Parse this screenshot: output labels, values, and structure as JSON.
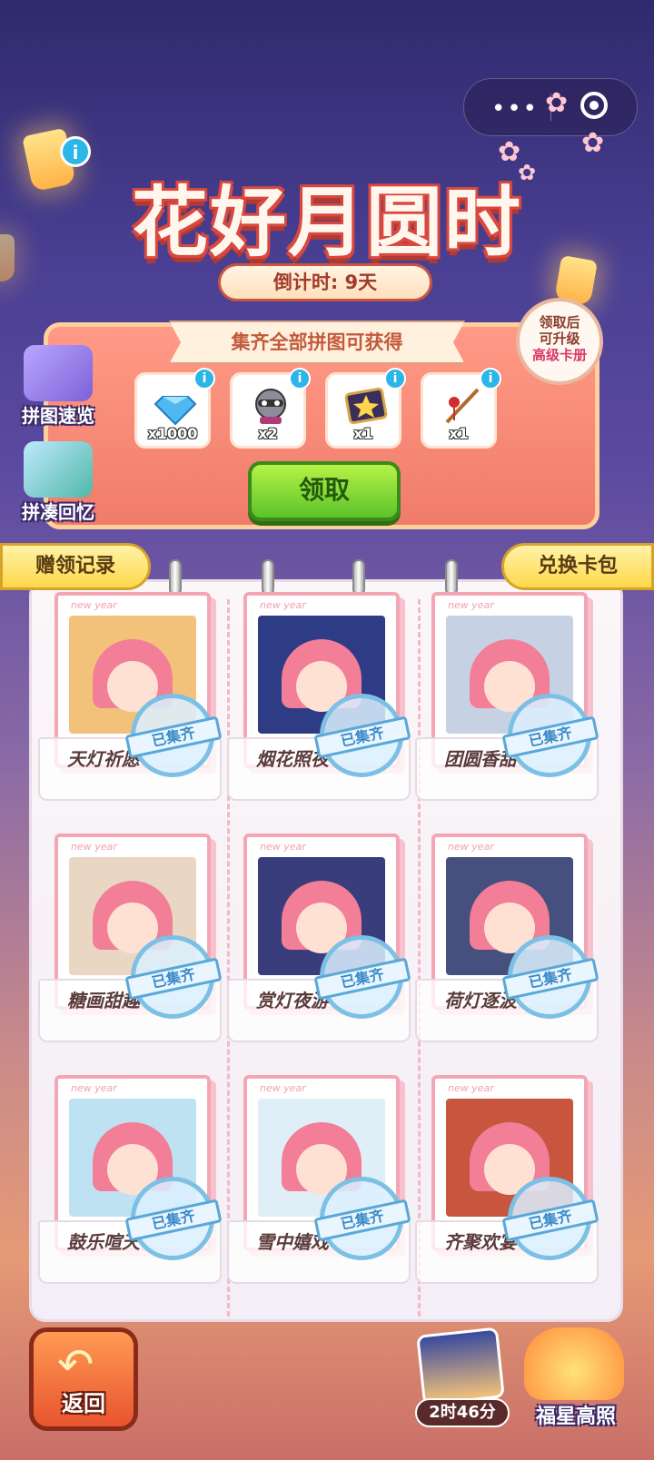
{
  "header": {
    "title": "花好月圆时",
    "countdown": "倒计时: 9天"
  },
  "reward_panel": {
    "banner": "集齐全部拼图可获得",
    "upgrade_badge": [
      "领取后",
      "可升级",
      "高级卡册"
    ],
    "rewards": [
      {
        "icon": "diamond-icon",
        "qty": "x1000"
      },
      {
        "icon": "raccoon-icon",
        "qty": "x2"
      },
      {
        "icon": "star-card-icon",
        "qty": "x1"
      },
      {
        "icon": "fishing-rod-icon",
        "qty": "x1"
      }
    ],
    "claim_label": "领取"
  },
  "side": {
    "preview_label": "拼图速览",
    "memory_label": "拼凑回忆"
  },
  "tabs": {
    "gift_record": "赠领记录",
    "exchange_pack": "兑换卡包"
  },
  "cards": [
    {
      "name": "天灯祈愿",
      "tag": "new year",
      "stamp": "已集齐",
      "art_color": "#f3c27a"
    },
    {
      "name": "烟花照夜",
      "tag": "new year",
      "stamp": "已集齐",
      "art_color": "#2d3c84"
    },
    {
      "name": "团圆香甜",
      "tag": "new year",
      "stamp": "已集齐",
      "art_color": "#c6d2e4"
    },
    {
      "name": "糖画甜趣",
      "tag": "new year",
      "stamp": "已集齐",
      "art_color": "#e9d7c4"
    },
    {
      "name": "赏灯夜游",
      "tag": "new year",
      "stamp": "已集齐",
      "art_color": "#3a3d7c"
    },
    {
      "name": "荷灯逐波",
      "tag": "new year",
      "stamp": "已集齐",
      "art_color": "#46507e"
    },
    {
      "name": "鼓乐喧天",
      "tag": "new year",
      "stamp": "已集齐",
      "art_color": "#bfe2f2"
    },
    {
      "name": "雪中嬉戏",
      "tag": "new year",
      "stamp": "已集齐",
      "art_color": "#dfeef7"
    },
    {
      "name": "齐聚欢宴",
      "tag": "new year",
      "stamp": "已集齐",
      "art_color": "#c8553e"
    }
  ],
  "bottom": {
    "back_label": "返回",
    "timer_label": "2时46分",
    "lucky_label": "福星高照"
  },
  "colors": {
    "accent_red": "#d8483f",
    "claim_green": "#5bc32a",
    "tab_yellow": "#ffd84a",
    "stamp_blue": "#3a8ac8"
  }
}
